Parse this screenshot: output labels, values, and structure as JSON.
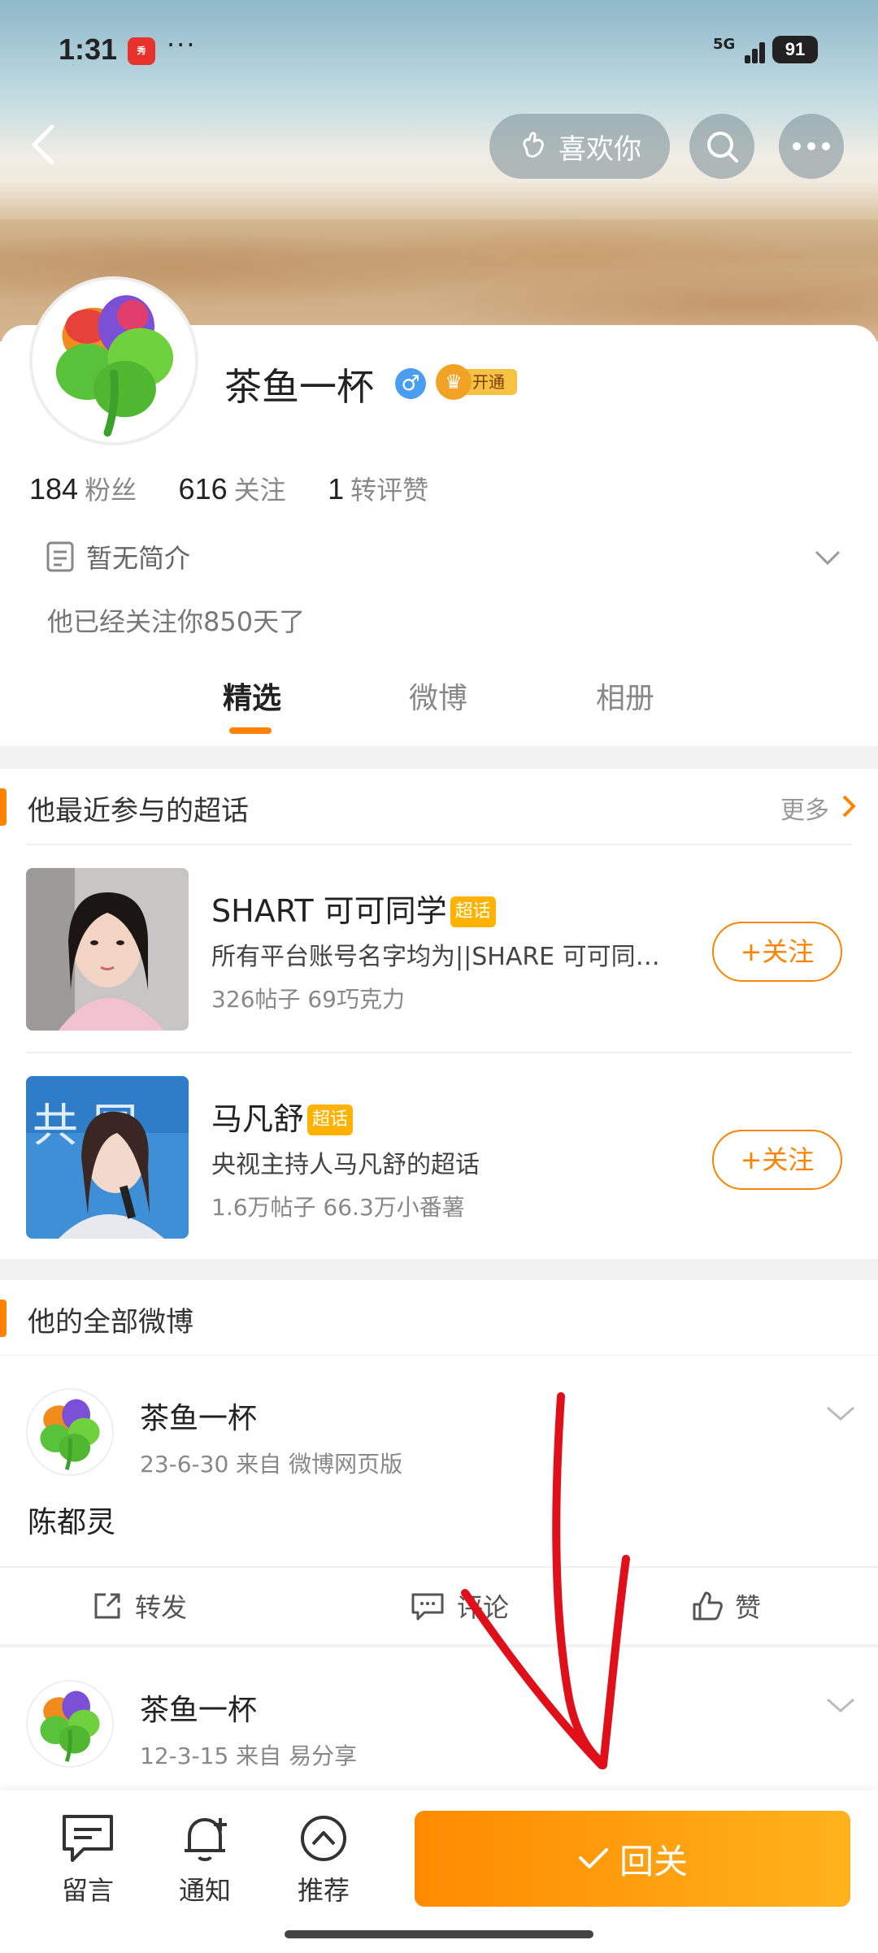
{
  "status_bar": {
    "time": "1:31",
    "app_icon_text": "秀",
    "more_dots": "···",
    "network": "5G",
    "battery": "91"
  },
  "header": {
    "like_label": "喜欢你"
  },
  "profile": {
    "name": "茶鱼一杯",
    "gender_symbol": "♂",
    "vip_label": "开通",
    "stats": [
      {
        "num": "184",
        "label": "粉丝"
      },
      {
        "num": "616",
        "label": "关注"
      },
      {
        "num": "1",
        "label": "转评赞"
      }
    ],
    "intro": "暂无简介",
    "follow_days": "他已经关注你850天了"
  },
  "tabs": [
    "精选",
    "微博",
    "相册"
  ],
  "supertopics": {
    "title": "他最近参与的超话",
    "more": "更多",
    "items": [
      {
        "name": "SHART 可可同学",
        "badge": "超话",
        "desc": "所有平台账号名字均为||SHARE 可可同学，其余均为假冒",
        "stats": "326帖子 69巧克力",
        "follow": "+关注"
      },
      {
        "name": "马凡舒",
        "badge": "超话",
        "desc": "央视主持人马凡舒的超话",
        "stats": "1.6万帖子 66.3万小番薯",
        "follow": "+关注"
      }
    ]
  },
  "all_posts": {
    "title": "他的全部微博",
    "posts": [
      {
        "name": "茶鱼一杯",
        "meta": "23-6-30  来自 微博网页版",
        "text": "陈都灵"
      },
      {
        "name": "茶鱼一杯",
        "meta": "12-3-15  来自 易分享",
        "text": ""
      }
    ],
    "actions": {
      "repost": "转发",
      "comment": "评论",
      "like": "赞"
    }
  },
  "bottom_bar": {
    "message": "留言",
    "notify": "通知",
    "recommend": "推荐",
    "follow_back": "回关"
  },
  "colors": {
    "accent": "#ff8200",
    "annotation": "#e0101a"
  }
}
